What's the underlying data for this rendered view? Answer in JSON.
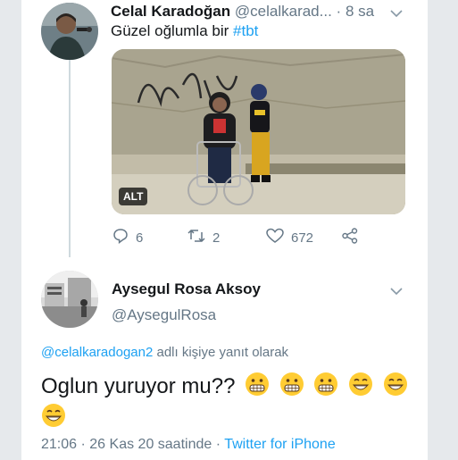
{
  "tweet1": {
    "display_name": "Celal Karadoğan",
    "handle": "@celalkarad...",
    "separator": "·",
    "time": "8 sa",
    "text_prefix": "Güzel oğlumla bir ",
    "hashtag": "#tbt",
    "media_alt_label": "ALT",
    "replies": "6",
    "retweets": "2",
    "likes": "672"
  },
  "tweet2": {
    "display_name": "Aysegul Rosa Aksoy",
    "handle": "@AysegulRosa",
    "reply_to_link": "@celalkaradogan2",
    "reply_to_suffix": " adlı kişiye yanıt olarak",
    "text": "Oglun yuruyor mu??",
    "time": "21:06",
    "separator": "·",
    "date": "26 Kas 20 saatinde",
    "separator2": "·",
    "client": "Twitter for iPhone"
  },
  "icons": [
    "chevron-down-icon",
    "reply-icon",
    "retweet-icon",
    "like-icon",
    "share-icon",
    "grimacing-face-emoji",
    "grinning-face-emoji"
  ],
  "colors": {
    "link": "#1da1f2",
    "muted": "#657786",
    "text": "#14171a"
  }
}
